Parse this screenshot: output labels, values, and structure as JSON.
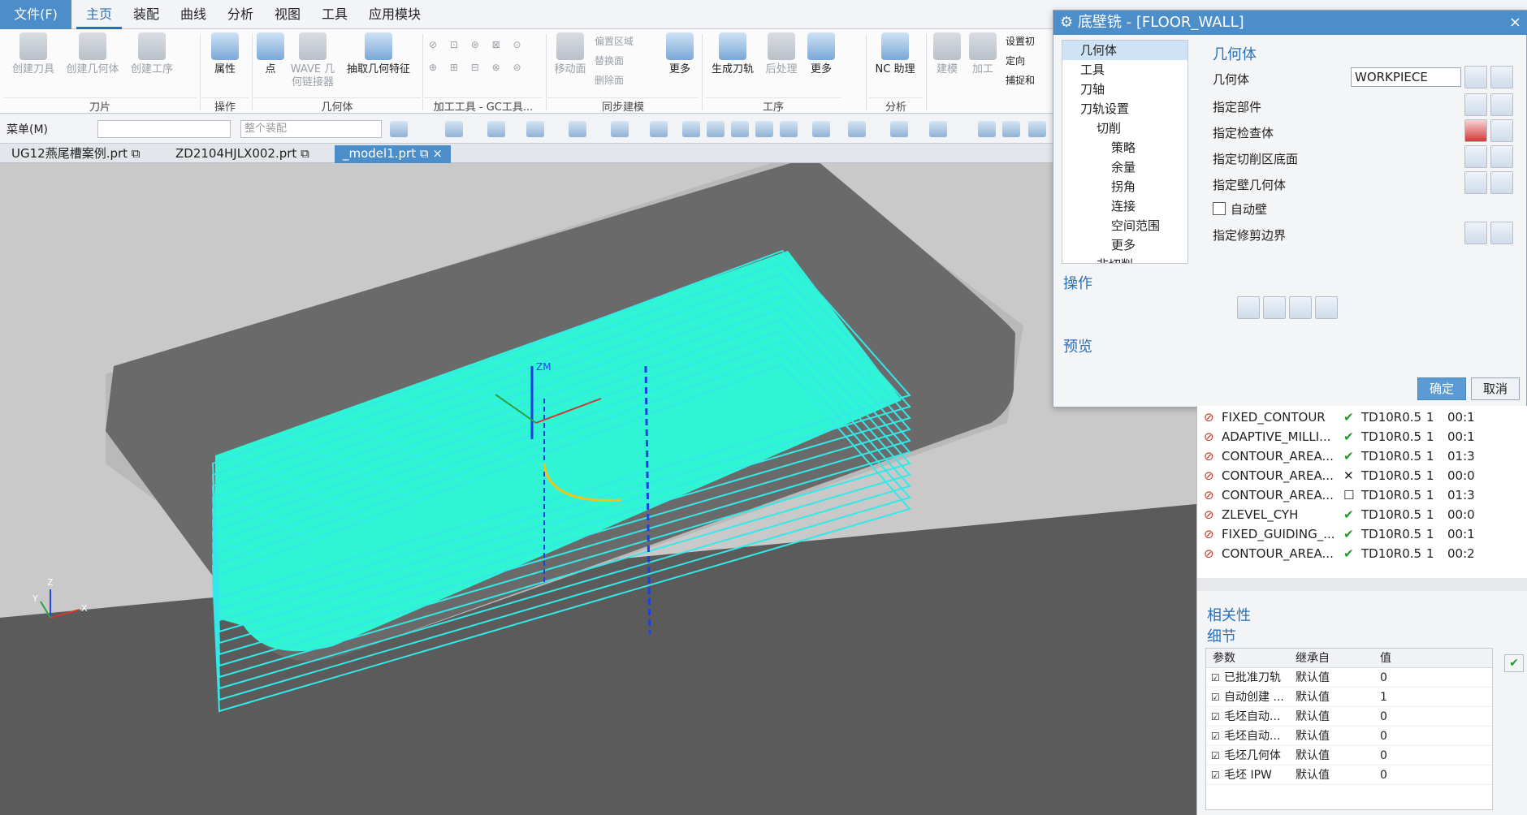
{
  "menubar": {
    "file": "文件(F)",
    "tabs": [
      "主页",
      "装配",
      "曲线",
      "分析",
      "视图",
      "工具",
      "应用模块"
    ]
  },
  "ribbon": {
    "groups": [
      {
        "label": "刀片",
        "buttons": [
          "创建刀具",
          "创建几何体",
          "创建工序"
        ]
      },
      {
        "label": "操作",
        "buttons": [
          "属性"
        ]
      },
      {
        "label": "几何体",
        "buttons": [
          "点",
          "WAVE 几何链接器",
          "抽取几何特征"
        ]
      },
      {
        "label": "加工工具 - GC工具...",
        "buttons": []
      },
      {
        "label": "同步建模",
        "buttons": [
          "移动面",
          "偏置区域",
          "替换面",
          "删除面",
          "更多"
        ]
      },
      {
        "label": "工序",
        "buttons": [
          "生成刀轨",
          "后处理",
          "更多"
        ]
      },
      {
        "label": "分析",
        "buttons": [
          "NC 助理"
        ]
      },
      {
        "label": "",
        "buttons": [
          "建模",
          "加工",
          "设置初",
          "定向",
          "捕捉和"
        ]
      }
    ]
  },
  "toolbar": {
    "menu": "菜单(M)",
    "combo1": "",
    "combo2": "整个装配"
  },
  "doctabs": [
    "UG12燕尾槽案例.prt",
    "ZD2104HJLX002.prt",
    "_model1.prt"
  ],
  "dialog": {
    "title": "底壁铣 - [FLOOR_WALL]",
    "tree": [
      "几何体",
      "工具",
      "刀轴",
      "刀轨设置",
      "切削",
      "策略",
      "余量",
      "拐角",
      "连接",
      "空间范围",
      "更多",
      "非切削"
    ],
    "geometry_section": "几何体",
    "geometry_label": "几何体",
    "geometry_value": "WORKPIECE",
    "rows": [
      "指定部件",
      "指定检查体",
      "指定切削区底面",
      "指定壁几何体",
      "自动壁",
      "指定修剪边界"
    ],
    "ops_section": "操作",
    "preview_section": "预览",
    "ok": "确定",
    "cancel": "取消"
  },
  "viewport": {
    "zm": "ZM",
    "wcs": [
      "X",
      "Y",
      "Z"
    ]
  },
  "navigator": {
    "ops": [
      {
        "name": "FIXED_CONTOUR",
        "status": "check",
        "tool": "TD10R0.5",
        "n": "1",
        "time": "00:1"
      },
      {
        "name": "ADAPTIVE_MILLI...",
        "status": "check",
        "tool": "TD10R0.5",
        "n": "1",
        "time": "00:1"
      },
      {
        "name": "CONTOUR_AREA...",
        "status": "check",
        "tool": "TD10R0.5",
        "n": "1",
        "time": "01:3"
      },
      {
        "name": "CONTOUR_AREA...",
        "status": "cross",
        "tool": "TD10R0.5",
        "n": "1",
        "time": "00:0"
      },
      {
        "name": "CONTOUR_AREA...",
        "status": "box",
        "tool": "TD10R0.5",
        "n": "1",
        "time": "01:3"
      },
      {
        "name": "ZLEVEL_CYH",
        "status": "check",
        "tool": "TD10R0.5",
        "n": "1",
        "time": "00:0"
      },
      {
        "name": "FIXED_GUIDING_...",
        "status": "check",
        "tool": "TD10R0.5",
        "n": "1",
        "time": "00:1"
      },
      {
        "name": "CONTOUR_AREA...",
        "status": "check",
        "tool": "TD10R0.5",
        "n": "1",
        "time": "00:2"
      }
    ],
    "relevance": "相关性",
    "details": "细节",
    "detail_headers": [
      "参数",
      "继承自",
      "值"
    ],
    "detail_rows": [
      {
        "p": "已批准刀轨",
        "i": "默认值",
        "v": "0"
      },
      {
        "p": "自动创建 ...",
        "i": "默认值",
        "v": "1"
      },
      {
        "p": "毛坯自动...",
        "i": "默认值",
        "v": "0"
      },
      {
        "p": "毛坯自动...",
        "i": "默认值",
        "v": "0"
      },
      {
        "p": "毛坯几何体",
        "i": "默认值",
        "v": "0"
      },
      {
        "p": "毛坯 IPW",
        "i": "默认值",
        "v": "0"
      }
    ]
  }
}
